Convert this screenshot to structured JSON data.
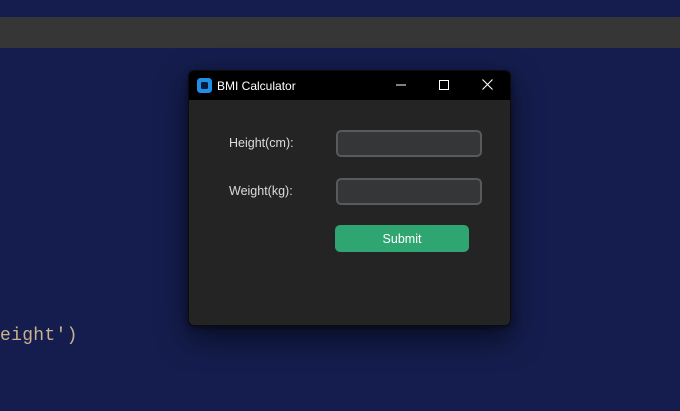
{
  "background": {
    "code_fragment": "eight')"
  },
  "window": {
    "title": "BMI Calculator",
    "icon": "app-icon",
    "controls": [
      "minimize-icon",
      "maximize-icon",
      "close-icon"
    ]
  },
  "form": {
    "height_label": "Height(cm):",
    "height_value": "",
    "weight_label": "Weight(kg):",
    "weight_value": "",
    "submit_label": "Submit"
  },
  "colors": {
    "desktop": "#141d4d",
    "window_bg": "#242424",
    "titlebar": "#000000",
    "entry_bg": "#343638",
    "entry_border": "#565b5e",
    "button": "#2fa572",
    "app_icon": "#1f8fe6"
  }
}
